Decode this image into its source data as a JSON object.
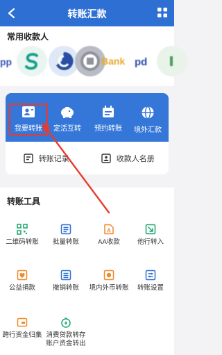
{
  "header": {
    "title": "转账汇款"
  },
  "payees": {
    "title": "常用收款人",
    "banks": [
      "ppd-logo",
      "s-bank-logo",
      "ccb-logo",
      "gray-bank-logo",
      "bank-logo",
      "pd-logo",
      "green-bank-logo"
    ],
    "bank_text": "Bank"
  },
  "quick_actions": [
    {
      "label": "我要转账",
      "icon": "id-card-icon"
    },
    {
      "label": "定活互转",
      "icon": "piggy-bank-icon"
    },
    {
      "label": "预约转账",
      "icon": "calendar-icon"
    },
    {
      "label": "境外汇款",
      "icon": "globe-icon"
    }
  ],
  "sub_actions": [
    {
      "label": "转账记录",
      "icon": "record-icon"
    },
    {
      "label": "收款人名册",
      "icon": "contacts-icon"
    }
  ],
  "tools": {
    "title": "转账工具",
    "items": [
      {
        "label": "二维码转账",
        "icon": "qr-code-icon"
      },
      {
        "label": "批量转账",
        "icon": "batch-icon"
      },
      {
        "label": "AA收款",
        "icon": "aa-icon"
      },
      {
        "label": "他行转入",
        "icon": "transfer-in-icon"
      },
      {
        "label": "公益捐款",
        "icon": "donation-icon"
      },
      {
        "label": "撤销转账",
        "icon": "revoke-icon"
      },
      {
        "label": "境内外币转账",
        "icon": "fx-transfer-icon"
      },
      {
        "label": "转账设置",
        "icon": "settings-icon"
      },
      {
        "label": "跨行资金归集",
        "icon": "collect-icon"
      },
      {
        "label": "消费贷款转存",
        "label2": "账户资金转出",
        "icon": "loan-icon"
      }
    ]
  },
  "colors": {
    "primary": "#2e6fd4",
    "panel": "#3577d8",
    "accent": "#e83b2f",
    "icon_green": "#1aa56a",
    "icon_blue": "#2e6fd4",
    "icon_orange": "#f0892b"
  }
}
